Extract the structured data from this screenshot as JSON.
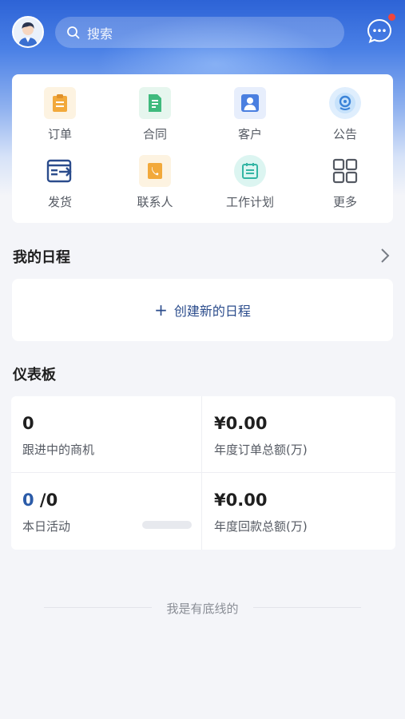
{
  "search": {
    "placeholder": "搜索"
  },
  "quick_actions": [
    {
      "label": "订单",
      "icon": "order-clipboard-icon"
    },
    {
      "label": "合同",
      "icon": "contract-document-icon"
    },
    {
      "label": "客户",
      "icon": "customer-person-icon"
    },
    {
      "label": "公告",
      "icon": "announcement-pin-icon"
    },
    {
      "label": "发货",
      "icon": "shipping-icon"
    },
    {
      "label": "联系人",
      "icon": "contact-phone-icon"
    },
    {
      "label": "工作计划",
      "icon": "work-plan-icon"
    },
    {
      "label": "更多",
      "icon": "more-grid-icon"
    }
  ],
  "schedule": {
    "title": "我的日程",
    "create_label": "创建新的日程"
  },
  "dashboard": {
    "title": "仪表板",
    "cells": [
      {
        "value": "0",
        "label": "跟进中的商机"
      },
      {
        "value": "¥0.00",
        "label": "年度订单总额(万)"
      },
      {
        "value_done": "0",
        "value_total": " /0",
        "label": "本日活动",
        "progress": 0
      },
      {
        "value": "¥0.00",
        "label": "年度回款总额(万)"
      }
    ]
  },
  "footer": {
    "text": "我是有底线的"
  },
  "colors": {
    "brand_blue": "#2d63d6",
    "accent_dark_blue": "#2b4c8c",
    "notification_dot": "#f0463c"
  }
}
